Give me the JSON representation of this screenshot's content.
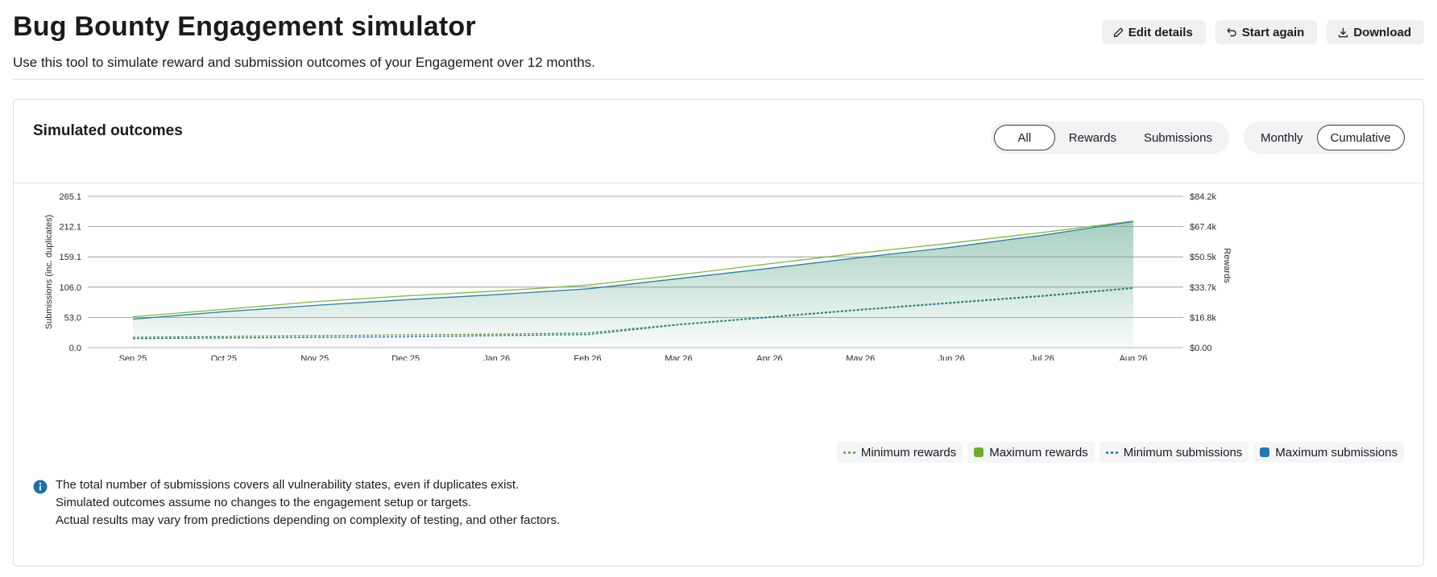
{
  "header": {
    "title": "Bug Bounty Engagement simulator",
    "subtitle": "Use this tool to simulate reward and submission outcomes of your Engagement over 12 months.",
    "actions": [
      {
        "label": "Edit details",
        "icon": "pencil-icon"
      },
      {
        "label": "Start again",
        "icon": "undo-icon"
      },
      {
        "label": "Download",
        "icon": "download-icon"
      }
    ]
  },
  "card": {
    "title": "Simulated outcomes",
    "view_toggle": {
      "options": [
        "All",
        "Rewards",
        "Submissions"
      ],
      "selected": "All"
    },
    "mode_toggle": {
      "options": [
        "Monthly",
        "Cumulative"
      ],
      "selected": "Cumulative"
    }
  },
  "legend": [
    {
      "label": "Minimum rewards",
      "style": "dotted",
      "color": "#5aa02c"
    },
    {
      "label": "Maximum rewards",
      "style": "solid",
      "color": "#6aae2b"
    },
    {
      "label": "Minimum submissions",
      "style": "dotted",
      "color": "#1a6fb0"
    },
    {
      "label": "Maximum submissions",
      "style": "solid",
      "color": "#1f78b4"
    }
  ],
  "notes": [
    "The total number of submissions covers all vulnerability states, even if duplicates exist.",
    "Simulated outcomes assume no changes to the engagement setup or targets.",
    "Actual results may vary from predictions depending on complexity of testing, and other factors."
  ],
  "colors": {
    "accent": "#1f7a5a",
    "info": "#1a6fb0"
  },
  "chart_data": {
    "type": "line",
    "mode": "cumulative",
    "x": [
      "Sep 25",
      "Oct 25",
      "Nov 25",
      "Dec 25",
      "Jan 26",
      "Feb 26",
      "Mar 26",
      "Apr 26",
      "May 26",
      "Jun 26",
      "Jul 26",
      "Aug 26"
    ],
    "y_left": {
      "label": "Submissions (inc. duplicates)",
      "ticks": [
        "0.0",
        "53.0",
        "106.0",
        "159.1",
        "212.1",
        "265.1"
      ],
      "range": [
        0,
        265.1
      ]
    },
    "y_right": {
      "label": "Rewards",
      "ticks": [
        "$0.00",
        "$16.8k",
        "$33.7k",
        "$50.5k",
        "$67.4k",
        "$84.2k"
      ],
      "range": [
        0,
        84200
      ]
    },
    "series": [
      {
        "name": "Maximum rewards",
        "axis": "right",
        "values": [
          17200,
          21300,
          25600,
          28800,
          31500,
          34800,
          40500,
          46700,
          52700,
          58200,
          64100,
          70400
        ]
      },
      {
        "name": "Maximum submissions",
        "axis": "left",
        "values": [
          50,
          63,
          74,
          84,
          93,
          103,
          121,
          139,
          158,
          176,
          197,
          221
        ]
      },
      {
        "name": "Minimum rewards",
        "axis": "right",
        "values": [
          5800,
          6200,
          6700,
          7100,
          7500,
          8200,
          13000,
          17200,
          21300,
          25200,
          29000,
          33400
        ]
      },
      {
        "name": "Minimum submissions",
        "axis": "left",
        "values": [
          16,
          17,
          18,
          19,
          21,
          23,
          40,
          53,
          66,
          78,
          90,
          104
        ]
      }
    ],
    "grid": true,
    "legend_position": "bottom-right"
  }
}
